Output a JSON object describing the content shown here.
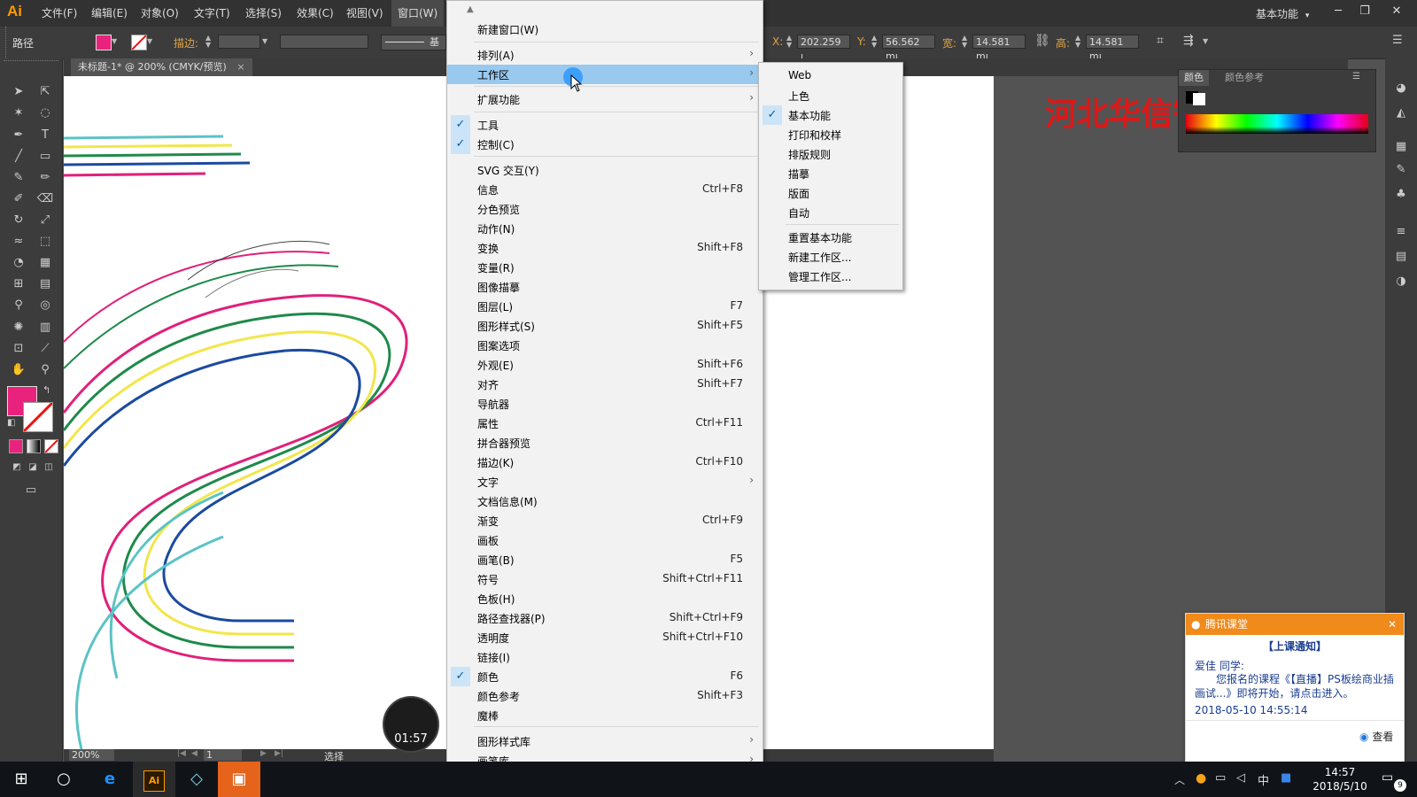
{
  "app": {
    "logo": "Ai",
    "menus": [
      "文件(F)",
      "编辑(E)",
      "对象(O)",
      "文字(T)",
      "选择(S)",
      "效果(C)",
      "视图(V)",
      "窗口(W)"
    ],
    "workspace_label": "基本功能",
    "workspace_arrow": "▾"
  },
  "window_controls": {
    "minimize": "─",
    "restore": "❐",
    "close": "✕"
  },
  "control_bar": {
    "object_type": "路径",
    "stroke_label": "描边:",
    "style_label": "基",
    "x_label": "X:",
    "x_value": "202.259 ı",
    "y_label": "Y:",
    "y_value": "56.562 mı",
    "w_label": "宽:",
    "w_value": "14.581 mı",
    "h_label": "高:",
    "h_value": "14.581 mı"
  },
  "document": {
    "tab_title": "未标题-1* @ 200% (CMYK/预览)",
    "tab_close": "×",
    "zoom": "200%",
    "page": "1",
    "status_text": "选择"
  },
  "watermark": "河北华信智原",
  "color_panel": {
    "tab_color": "颜色",
    "tab_color_guide": "颜色参考"
  },
  "window_menu": {
    "items": [
      {
        "label": "新建窗口(W)",
        "shortcut": "",
        "submenu": false,
        "checked": false
      },
      {
        "label": "排列(A)",
        "shortcut": "",
        "submenu": true,
        "checked": false
      },
      {
        "label": "工作区",
        "shortcut": "",
        "submenu": true,
        "checked": false,
        "highlighted": true
      },
      {
        "label": "扩展功能",
        "shortcut": "",
        "submenu": true,
        "checked": false
      },
      {
        "label": "工具",
        "shortcut": "",
        "submenu": false,
        "checked": true
      },
      {
        "label": "控制(C)",
        "shortcut": "",
        "submenu": false,
        "checked": true
      },
      {
        "label": "SVG 交互(Y)",
        "shortcut": "",
        "submenu": false,
        "checked": false
      },
      {
        "label": "信息",
        "shortcut": "Ctrl+F8",
        "submenu": false,
        "checked": false
      },
      {
        "label": "分色预览",
        "shortcut": "",
        "submenu": false,
        "checked": false
      },
      {
        "label": "动作(N)",
        "shortcut": "",
        "submenu": false,
        "checked": false
      },
      {
        "label": "变换",
        "shortcut": "Shift+F8",
        "submenu": false,
        "checked": false
      },
      {
        "label": "变量(R)",
        "shortcut": "",
        "submenu": false,
        "checked": false
      },
      {
        "label": "图像描摹",
        "shortcut": "",
        "submenu": false,
        "checked": false
      },
      {
        "label": "图层(L)",
        "shortcut": "F7",
        "submenu": false,
        "checked": false
      },
      {
        "label": "图形样式(S)",
        "shortcut": "Shift+F5",
        "submenu": false,
        "checked": false
      },
      {
        "label": "图案选项",
        "shortcut": "",
        "submenu": false,
        "checked": false
      },
      {
        "label": "外观(E)",
        "shortcut": "Shift+F6",
        "submenu": false,
        "checked": false
      },
      {
        "label": "对齐",
        "shortcut": "Shift+F7",
        "submenu": false,
        "checked": false
      },
      {
        "label": "导航器",
        "shortcut": "",
        "submenu": false,
        "checked": false
      },
      {
        "label": "属性",
        "shortcut": "Ctrl+F11",
        "submenu": false,
        "checked": false
      },
      {
        "label": "拼合器预览",
        "shortcut": "",
        "submenu": false,
        "checked": false
      },
      {
        "label": "描边(K)",
        "shortcut": "Ctrl+F10",
        "submenu": false,
        "checked": false
      },
      {
        "label": "文字",
        "shortcut": "",
        "submenu": true,
        "checked": false
      },
      {
        "label": "文档信息(M)",
        "shortcut": "",
        "submenu": false,
        "checked": false
      },
      {
        "label": "渐变",
        "shortcut": "Ctrl+F9",
        "submenu": false,
        "checked": false
      },
      {
        "label": "画板",
        "shortcut": "",
        "submenu": false,
        "checked": false
      },
      {
        "label": "画笔(B)",
        "shortcut": "F5",
        "submenu": false,
        "checked": false
      },
      {
        "label": "符号",
        "shortcut": "Shift+Ctrl+F11",
        "submenu": false,
        "checked": false
      },
      {
        "label": "色板(H)",
        "shortcut": "",
        "submenu": false,
        "checked": false
      },
      {
        "label": "路径查找器(P)",
        "shortcut": "Shift+Ctrl+F9",
        "submenu": false,
        "checked": false
      },
      {
        "label": "透明度",
        "shortcut": "Shift+Ctrl+F10",
        "submenu": false,
        "checked": false
      },
      {
        "label": "链接(I)",
        "shortcut": "",
        "submenu": false,
        "checked": false
      },
      {
        "label": "颜色",
        "shortcut": "F6",
        "submenu": false,
        "checked": true
      },
      {
        "label": "颜色参考",
        "shortcut": "Shift+F3",
        "submenu": false,
        "checked": false
      },
      {
        "label": "魔棒",
        "shortcut": "",
        "submenu": false,
        "checked": false
      },
      {
        "label": "图形样式库",
        "shortcut": "",
        "submenu": true,
        "checked": false
      },
      {
        "label": "画笔库",
        "shortcut": "",
        "submenu": true,
        "checked": false
      }
    ]
  },
  "workspace_submenu": {
    "items": [
      {
        "label": "Web",
        "checked": false
      },
      {
        "label": "上色",
        "checked": false
      },
      {
        "label": "基本功能",
        "checked": true
      },
      {
        "label": "打印和校样",
        "checked": false
      },
      {
        "label": "排版规则",
        "checked": false
      },
      {
        "label": "描摹",
        "checked": false
      },
      {
        "label": "版面",
        "checked": false
      },
      {
        "label": "自动",
        "checked": false
      },
      {
        "label": "重置基本功能",
        "checked": false
      },
      {
        "label": "新建工作区...",
        "checked": false
      },
      {
        "label": "管理工作区...",
        "checked": false
      }
    ]
  },
  "timer": "01:57",
  "notification": {
    "app_name": "腾讯课堂",
    "close": "✕",
    "title": "【上课通知】",
    "greeting": "爱佳 同学:",
    "body": "您报名的课程《【直播】PS板绘商业插画试...》即将开始，请点击进入。",
    "time": "2018-05-10 14:55:14",
    "view": "查看"
  },
  "taskbar": {
    "clock_time": "14:57",
    "clock_date": "2018/5/10",
    "ime": "中",
    "notification_count": "9",
    "ai_label": "Ai"
  },
  "colors": {
    "accent_highlight": "#99c9ef",
    "fill_swatch": "#e9237d",
    "notify_header": "#f08a1a"
  }
}
